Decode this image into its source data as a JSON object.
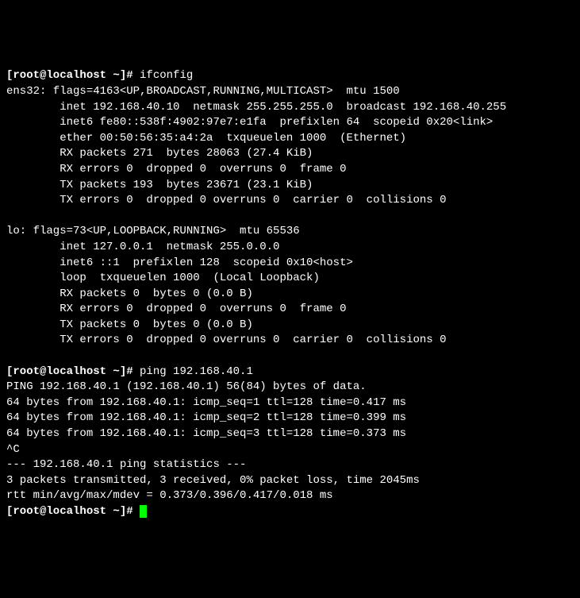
{
  "lines": {
    "p1_prefix": "[root@localhost ~]# ",
    "p1_cmd": "ifconfig",
    "l01": "ens32: flags=4163<UP,BROADCAST,RUNNING,MULTICAST>  mtu 1500",
    "l02": "        inet 192.168.40.10  netmask 255.255.255.0  broadcast 192.168.40.255",
    "l03": "        inet6 fe80::538f:4902:97e7:e1fa  prefixlen 64  scopeid 0x20<link>",
    "l04": "        ether 00:50:56:35:a4:2a  txqueuelen 1000  (Ethernet)",
    "l05": "        RX packets 271  bytes 28063 (27.4 KiB)",
    "l06": "        RX errors 0  dropped 0  overruns 0  frame 0",
    "l07": "        TX packets 193  bytes 23671 (23.1 KiB)",
    "l08": "        TX errors 0  dropped 0 overruns 0  carrier 0  collisions 0",
    "l09": "",
    "l10": "lo: flags=73<UP,LOOPBACK,RUNNING>  mtu 65536",
    "l11": "        inet 127.0.0.1  netmask 255.0.0.0",
    "l12": "        inet6 ::1  prefixlen 128  scopeid 0x10<host>",
    "l13": "        loop  txqueuelen 1000  (Local Loopback)",
    "l14": "        RX packets 0  bytes 0 (0.0 B)",
    "l15": "        RX errors 0  dropped 0  overruns 0  frame 0",
    "l16": "        TX packets 0  bytes 0 (0.0 B)",
    "l17": "        TX errors 0  dropped 0 overruns 0  carrier 0  collisions 0",
    "l18": "",
    "p2_prefix": "[root@localhost ~]# ",
    "p2_cmd": "ping 192.168.40.1",
    "l19": "PING 192.168.40.1 (192.168.40.1) 56(84) bytes of data.",
    "l20": "64 bytes from 192.168.40.1: icmp_seq=1 ttl=128 time=0.417 ms",
    "l21": "64 bytes from 192.168.40.1: icmp_seq=2 ttl=128 time=0.399 ms",
    "l22": "64 bytes from 192.168.40.1: icmp_seq=3 ttl=128 time=0.373 ms",
    "l23": "^C",
    "l24": "--- 192.168.40.1 ping statistics ---",
    "l25": "3 packets transmitted, 3 received, 0% packet loss, time 2045ms",
    "l26": "rtt min/avg/max/mdev = 0.373/0.396/0.417/0.018 ms",
    "p3_prefix": "[root@localhost ~]# "
  }
}
